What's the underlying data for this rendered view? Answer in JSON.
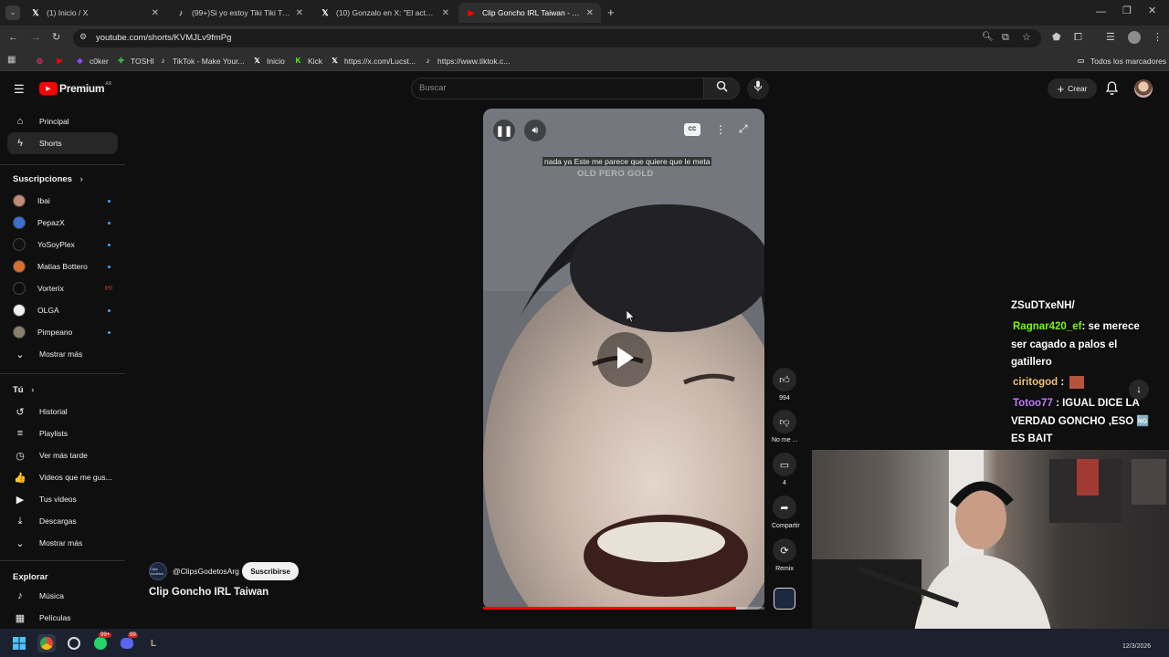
{
  "browser": {
    "tabs": [
      {
        "title": "(1) Inicio / X",
        "icon": "x-logo-icon",
        "glyph": "𝕏",
        "active": false
      },
      {
        "title": "(99+)Si yo estoy Tiki Tiki Tiki 🤬",
        "icon": "tiktok-icon",
        "glyph": "♪",
        "active": false
      },
      {
        "title": "(10) Gonzalo en X: \"El actor de",
        "icon": "x-logo-icon",
        "glyph": "𝕏",
        "active": false
      },
      {
        "title": "Clip Goncho IRL Taiwan - YouTube",
        "icon": "youtube-icon",
        "glyph": "▶",
        "active": true
      }
    ],
    "url": "youtube.com/shorts/KVMJLv9fmPg",
    "bookmarks": [
      {
        "label": "",
        "icon": "instagram-icon",
        "glyph": "◎"
      },
      {
        "label": "",
        "icon": "youtube-bookmark-icon",
        "glyph": "▶"
      },
      {
        "label": "c0ker",
        "icon": "twitch-icon",
        "glyph": "◆"
      },
      {
        "label": "TOSHI",
        "icon": "toshi-icon",
        "glyph": "✚"
      },
      {
        "label": "TikTok - Make Your...",
        "icon": "tiktok-icon",
        "glyph": "♪"
      },
      {
        "label": "Inicio",
        "icon": "x-logo-icon",
        "glyph": "𝕏"
      },
      {
        "label": "Kick",
        "icon": "kick-icon",
        "glyph": "K"
      },
      {
        "label": "https://x.com/Lucst...",
        "icon": "x-logo-icon",
        "glyph": "𝕏"
      },
      {
        "label": "https://www.tiktok.c...",
        "icon": "tiktok-icon",
        "glyph": "♪"
      }
    ],
    "all_bookmarks_label": "Todos los marcadores"
  },
  "header": {
    "logo_text": "Premium",
    "logo_country": "AR",
    "search_placeholder": "Buscar",
    "create_label": "Crear"
  },
  "sidebar": {
    "main": [
      {
        "label": "Principal",
        "icon": "home-icon",
        "glyph": "⌂"
      },
      {
        "label": "Shorts",
        "icon": "shorts-icon",
        "glyph": "ϟ"
      }
    ],
    "subscriptions_heading": "Suscripciones",
    "subscriptions": [
      {
        "label": "Ibai",
        "color": "#c08a76",
        "marker": "dot"
      },
      {
        "label": "PepazX",
        "color": "#3b6fd8",
        "marker": "dot"
      },
      {
        "label": "YoSoyPlex",
        "color": "#111111",
        "marker": "dot"
      },
      {
        "label": "Matias Bottero",
        "color": "#d9702f",
        "marker": "dot"
      },
      {
        "label": "Vorterix",
        "color": "#0f0f0f",
        "marker": "live"
      },
      {
        "label": "OLGA",
        "color": "#f0f0f0",
        "marker": "dot"
      },
      {
        "label": "Pimpeano",
        "color": "#8a7f6a",
        "marker": "dot"
      }
    ],
    "show_more_1": "Mostrar más",
    "you_heading": "Tú",
    "you_items": [
      {
        "label": "Historial",
        "icon": "history-icon",
        "glyph": "↺"
      },
      {
        "label": "Playlists",
        "icon": "playlist-icon",
        "glyph": "≡"
      },
      {
        "label": "Ver más tarde",
        "icon": "clock-icon",
        "glyph": "◷"
      },
      {
        "label": "Videos que me gus...",
        "icon": "thumbs-up-icon",
        "glyph": "👍"
      },
      {
        "label": "Tus videos",
        "icon": "video-icon",
        "glyph": "▶"
      },
      {
        "label": "Descargas",
        "icon": "download-icon",
        "glyph": "⤓"
      }
    ],
    "show_more_2": "Mostrar más",
    "explore_heading": "Explorar",
    "explore_items": [
      {
        "label": "Música",
        "icon": "music-icon",
        "glyph": "♪"
      },
      {
        "label": "Películas",
        "icon": "film-icon",
        "glyph": "▦"
      }
    ]
  },
  "video": {
    "caption": "nada ya Este me parece que quiere que le meta",
    "watermark": "OLD PERO GOLD",
    "progress": 0.9
  },
  "actions": {
    "like_count": "994",
    "dislike_label": "No me ...",
    "comment_count": "4",
    "share_label": "Compartir",
    "remix_label": "Remix"
  },
  "channel": {
    "handle": "@ClipsGodetosArg",
    "subscribe_label": "Suscribirse",
    "avatar_text": "Clips Godetos",
    "title": "Clip Goncho IRL Taiwan"
  },
  "stream_chat": [
    {
      "user": "",
      "user_color": "#ffffff",
      "text": "ZSuDTxeNH/"
    },
    {
      "user": "Ragnar420_ef",
      "user_color": "#7CFC00",
      "text": ": se merece ser cagado a palos el gatillero"
    },
    {
      "user": "ciritogod",
      "user_color": "#f4c27a",
      "text": " :"
    },
    {
      "user": "Totoo77",
      "user_color": "#c77dff",
      "text": " : IGUAL DICE LA VERDAD GONCHO ,ESO 🆖 ES BAIT"
    }
  ],
  "taskbar": {
    "whatsapp_badge": "99+",
    "discord_badge": "99",
    "date_label": "12/3/2026"
  }
}
